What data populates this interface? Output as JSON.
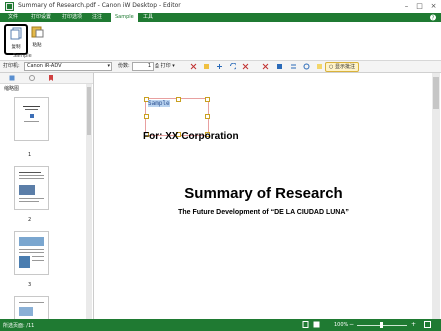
{
  "window": {
    "title": "Summary of Research.pdf - Canon iW Desktop - Editor"
  },
  "menu": {
    "tabs": [
      "文件",
      "打印设置",
      "打印选项",
      "注注",
      "Sample",
      "工具"
    ],
    "active": "Sample"
  },
  "ribbon": {
    "copy_label": "复制",
    "paste_label": "粘贴",
    "group_label": "Sample"
  },
  "toolbar": {
    "printer_label": "打印机:",
    "printer_value": "Canon iR-ADV",
    "copies_label": "份数:",
    "copies_value": "1",
    "print_label": "打印",
    "show_comments_label": "显示批注"
  },
  "panel": {
    "title": "缩略图",
    "pages": [
      "1",
      "2",
      "3"
    ]
  },
  "document": {
    "annotation_text": "Sample",
    "company": "For: XX Corporation",
    "title": "Summary of Research",
    "subtitle": "The Future Development of “DE LA CIUDAD LUNA”"
  },
  "status": {
    "page_info": "所选页面: /11",
    "zoom": "100%"
  },
  "colors": {
    "brand_green": "#1f7a32",
    "annotation_border": "#e8a0a0"
  }
}
